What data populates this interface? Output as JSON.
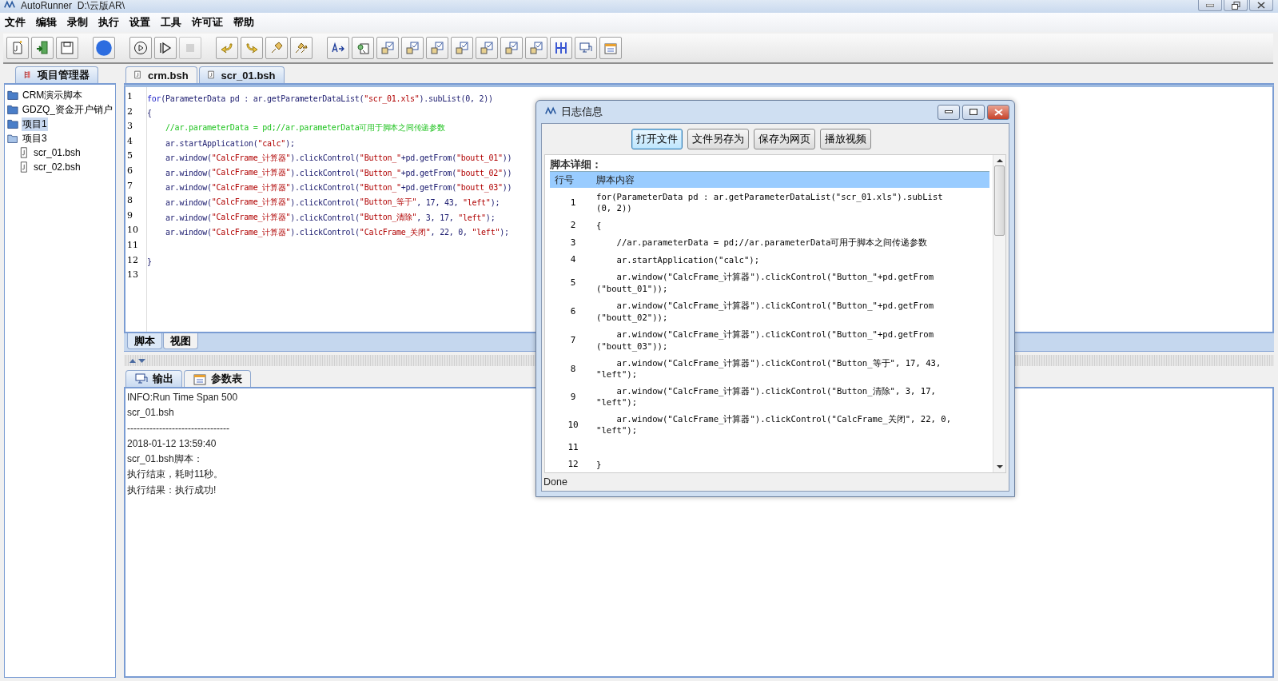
{
  "window": {
    "title": "AutoRunner  D:\\云版AR\\"
  },
  "menu": [
    "文件",
    "编辑",
    "录制",
    "执行",
    "设置",
    "工具",
    "许可证",
    "帮助"
  ],
  "toolbar": [
    {
      "kind": "script"
    },
    {
      "kind": "import"
    },
    {
      "kind": "save"
    },
    {
      "kind": "separator"
    },
    {
      "kind": "record"
    },
    {
      "kind": "separator"
    },
    {
      "kind": "play"
    },
    {
      "kind": "step"
    },
    {
      "kind": "stop",
      "disabled": true
    },
    {
      "kind": "separator"
    },
    {
      "kind": "undo"
    },
    {
      "kind": "redo"
    },
    {
      "kind": "pin"
    },
    {
      "kind": "pins"
    },
    {
      "kind": "separator"
    },
    {
      "kind": "text"
    },
    {
      "kind": "find"
    },
    {
      "kind": "check"
    },
    {
      "kind": "check"
    },
    {
      "kind": "check"
    },
    {
      "kind": "check"
    },
    {
      "kind": "check"
    },
    {
      "kind": "check"
    },
    {
      "kind": "check"
    },
    {
      "kind": "columns"
    },
    {
      "kind": "monitor"
    },
    {
      "kind": "calendar"
    }
  ],
  "project_panel": {
    "title": "项目管理器",
    "tree": [
      {
        "label": "CRM演示脚本",
        "kind": "folder",
        "selected": false
      },
      {
        "label": "GDZQ_资金开户销户",
        "kind": "folder",
        "selected": false
      },
      {
        "label": "项目1",
        "kind": "folder",
        "selected": true
      },
      {
        "label": "项目3",
        "kind": "folder",
        "selected": false,
        "expanded": true,
        "children": [
          {
            "label": "scr_01.bsh",
            "kind": "file",
            "selected": false
          },
          {
            "label": "scr_02.bsh",
            "kind": "file",
            "selected": false
          }
        ]
      }
    ]
  },
  "editor_tabs": [
    {
      "label": "crm.bsh",
      "selected": false
    },
    {
      "label": "scr_01.bsh",
      "selected": true
    }
  ],
  "editor_lines": [
    {
      "number": "1",
      "segments": [
        {
          "kind": "keyword",
          "text": "for"
        },
        {
          "kind": "plain",
          "text": "(ParameterData pd : ar.getParameterDataList("
        },
        {
          "kind": "string",
          "text": "\"scr_01.xls\""
        },
        {
          "kind": "plain",
          "text": ").subList(0, 2))"
        }
      ]
    },
    {
      "number": "2",
      "segments": [
        {
          "kind": "plain",
          "text": "{"
        }
      ]
    },
    {
      "number": "3",
      "segments": [
        {
          "kind": "comment",
          "text": "    //ar.parameterData = pd;//ar.parameterData可用于脚本之间传递参数"
        }
      ]
    },
    {
      "number": "4",
      "segments": [
        {
          "kind": "plain",
          "text": "    ar.startApplication("
        },
        {
          "kind": "string",
          "text": "\"calc\""
        },
        {
          "kind": "plain",
          "text": ");"
        }
      ]
    },
    {
      "number": "5",
      "segments": [
        {
          "kind": "plain",
          "text": "    ar.window("
        },
        {
          "kind": "string",
          "text": "\"CalcFrame_计算器\""
        },
        {
          "kind": "plain",
          "text": ").clickControl("
        },
        {
          "kind": "string",
          "text": "\"Button_\""
        },
        {
          "kind": "plain",
          "text": "+pd.getFrom("
        },
        {
          "kind": "string",
          "text": "\"boutt_01\""
        },
        {
          "kind": "plain",
          "text": "))"
        }
      ]
    },
    {
      "number": "6",
      "segments": [
        {
          "kind": "plain",
          "text": "    ar.window("
        },
        {
          "kind": "string",
          "text": "\"CalcFrame_计算器\""
        },
        {
          "kind": "plain",
          "text": ").clickControl("
        },
        {
          "kind": "string",
          "text": "\"Button_\""
        },
        {
          "kind": "plain",
          "text": "+pd.getFrom("
        },
        {
          "kind": "string",
          "text": "\"boutt_02\""
        },
        {
          "kind": "plain",
          "text": "))"
        }
      ]
    },
    {
      "number": "7",
      "segments": [
        {
          "kind": "plain",
          "text": "    ar.window("
        },
        {
          "kind": "string",
          "text": "\"CalcFrame_计算器\""
        },
        {
          "kind": "plain",
          "text": ").clickControl("
        },
        {
          "kind": "string",
          "text": "\"Button_\""
        },
        {
          "kind": "plain",
          "text": "+pd.getFrom("
        },
        {
          "kind": "string",
          "text": "\"boutt_03\""
        },
        {
          "kind": "plain",
          "text": "))"
        }
      ]
    },
    {
      "number": "8",
      "segments": [
        {
          "kind": "plain",
          "text": "    ar.window("
        },
        {
          "kind": "string",
          "text": "\"CalcFrame_计算器\""
        },
        {
          "kind": "plain",
          "text": ").clickControl("
        },
        {
          "kind": "string",
          "text": "\"Button_等于\""
        },
        {
          "kind": "plain",
          "text": ", 17, 43, "
        },
        {
          "kind": "string",
          "text": "\"left\""
        },
        {
          "kind": "plain",
          "text": ");"
        }
      ]
    },
    {
      "number": "9",
      "segments": [
        {
          "kind": "plain",
          "text": "    ar.window("
        },
        {
          "kind": "string",
          "text": "\"CalcFrame_计算器\""
        },
        {
          "kind": "plain",
          "text": ").clickControl("
        },
        {
          "kind": "string",
          "text": "\"Button_清除\""
        },
        {
          "kind": "plain",
          "text": ", 3, 17, "
        },
        {
          "kind": "string",
          "text": "\"left\""
        },
        {
          "kind": "plain",
          "text": ");"
        }
      ]
    },
    {
      "number": "10",
      "segments": [
        {
          "kind": "plain",
          "text": "    ar.window("
        },
        {
          "kind": "string",
          "text": "\"CalcFrame_计算器\""
        },
        {
          "kind": "plain",
          "text": ").clickControl("
        },
        {
          "kind": "string",
          "text": "\"CalcFrame_关闭\""
        },
        {
          "kind": "plain",
          "text": ", 22, 0, "
        },
        {
          "kind": "string",
          "text": "\"left\""
        },
        {
          "kind": "plain",
          "text": ");"
        }
      ]
    },
    {
      "number": "11"
    },
    {
      "number": "12",
      "segments": [
        {
          "kind": "plain",
          "text": "}"
        }
      ]
    },
    {
      "number": "13"
    }
  ],
  "view_tabs": [
    {
      "label": "脚本",
      "selected": true
    },
    {
      "label": "视图",
      "selected": false
    }
  ],
  "output_tabs": [
    {
      "label": "输出",
      "kind": "monitor",
      "selected": true
    },
    {
      "label": "参数表",
      "kind": "calendar",
      "selected": false
    }
  ],
  "output_lines": [
    "INFO:Run Time Span 500",
    "scr_01.bsh",
    "--------------------------------",
    "2018-01-12 13:59:40",
    "scr_01.bsh脚本：",
    "执行结束，耗时11秒。",
    "执行结果：执行成功!"
  ],
  "log_dialog": {
    "title": "日志信息",
    "buttons": [
      {
        "label": "打开文件",
        "selected": true
      },
      {
        "label": "文件另存为",
        "selected": false
      },
      {
        "label": "保存为网页",
        "selected": false
      },
      {
        "label": "播放视频",
        "selected": false
      }
    ],
    "heading": "脚本详细：",
    "columns": [
      "行号",
      "脚本内容"
    ],
    "rows": [
      {
        "number": "1",
        "content": "for(ParameterData pd : ar.getParameterDataList(\"scr_01.xls\").subList\n(0, 2))"
      },
      {
        "number": "2",
        "content": "{"
      },
      {
        "number": "3",
        "content": "    //ar.parameterData = pd;//ar.parameterData可用于脚本之间传递参数"
      },
      {
        "number": "4",
        "content": "    ar.startApplication(\"calc\");"
      },
      {
        "number": "5",
        "content": "    ar.window(\"CalcFrame_计算器\").clickControl(\"Button_\"+pd.getFrom\n(\"boutt_01\"));"
      },
      {
        "number": "6",
        "content": "    ar.window(\"CalcFrame_计算器\").clickControl(\"Button_\"+pd.getFrom\n(\"boutt_02\"));"
      },
      {
        "number": "7",
        "content": "    ar.window(\"CalcFrame_计算器\").clickControl(\"Button_\"+pd.getFrom\n(\"boutt_03\"));"
      },
      {
        "number": "8",
        "content": "    ar.window(\"CalcFrame_计算器\").clickControl(\"Button_等于\", 17, 43, \"left\");"
      },
      {
        "number": "9",
        "content": "    ar.window(\"CalcFrame_计算器\").clickControl(\"Button_清除\", 3, 17, \"left\");"
      },
      {
        "number": "10",
        "content": "    ar.window(\"CalcFrame_计算器\").clickControl(\"CalcFrame_关闭\", 22, 0, \"left\");"
      },
      {
        "number": "11"
      },
      {
        "number": "12",
        "content": "}"
      }
    ],
    "status": "Done"
  }
}
